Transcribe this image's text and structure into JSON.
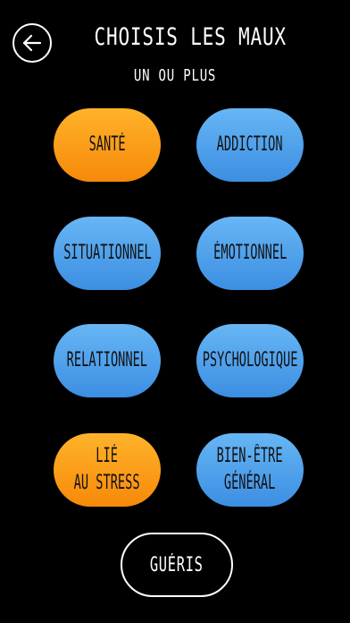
{
  "header": {
    "title": "CHOISIS LES MAUX",
    "subtitle": "UN OU PLUS"
  },
  "colors": {
    "background": "#000000",
    "selected": "#f7890a",
    "unselected": "#3c8ee2",
    "text_on_buttons": "#111111"
  },
  "options": [
    {
      "label": "SANTÉ",
      "selected": true
    },
    {
      "label": "ADDICTION",
      "selected": false
    },
    {
      "label": "SITUATIONNEL",
      "selected": false
    },
    {
      "label": "ÉMOTIONNEL",
      "selected": false
    },
    {
      "label": "RELATIONNEL",
      "selected": false
    },
    {
      "label": "PSYCHOLOGIQUE",
      "selected": false
    },
    {
      "label": "LIÉ\nAU STRESS",
      "selected": true
    },
    {
      "label": "BIEN-ÊTRE\nGÉNÉRAL",
      "selected": false
    }
  ],
  "footer": {
    "heal_label": "GUÉRIS"
  },
  "icons": {
    "back": "arrow-left-icon"
  }
}
